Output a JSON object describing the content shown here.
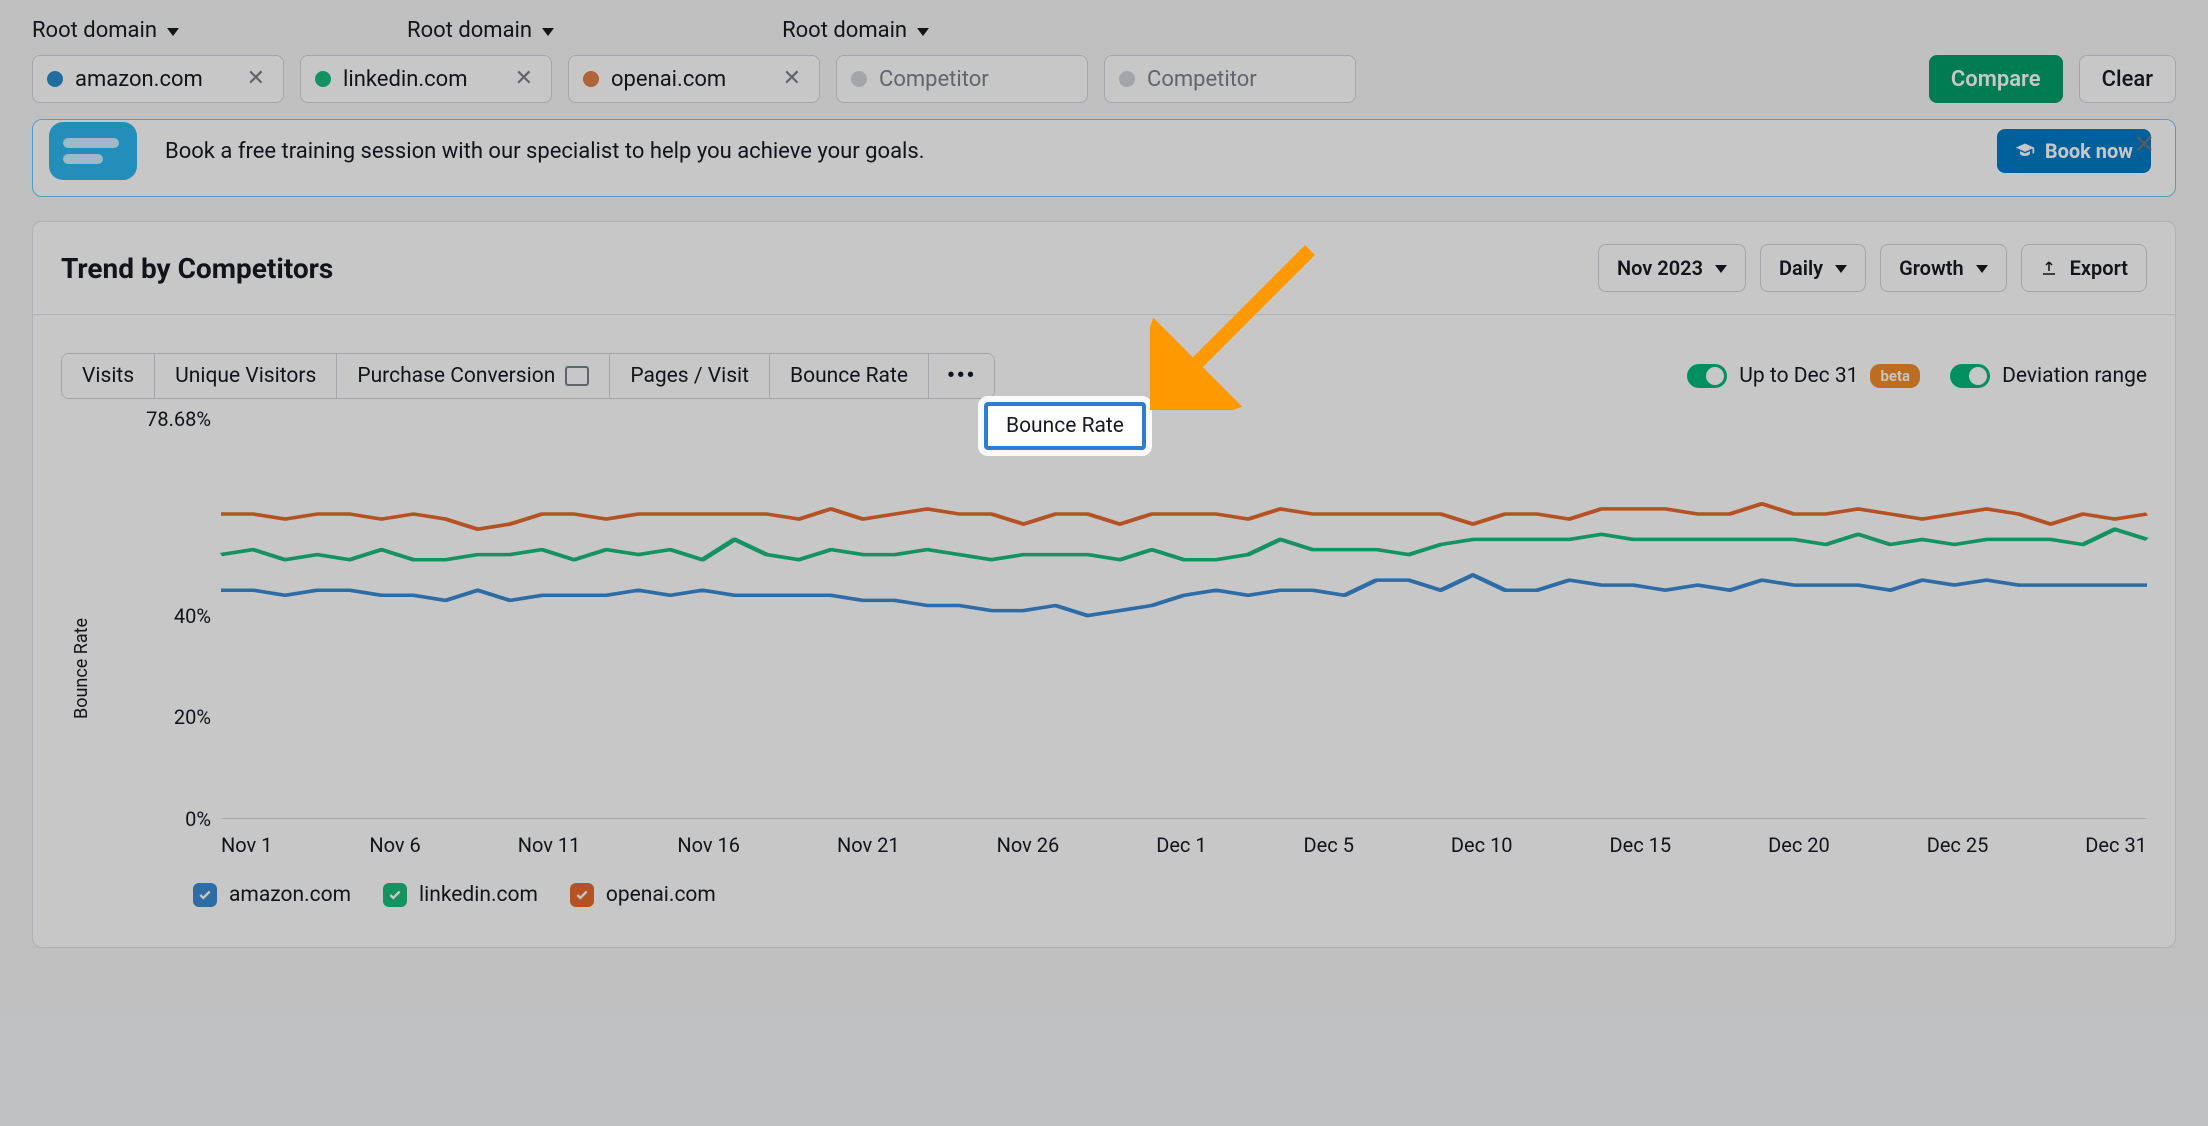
{
  "top": {
    "root_label": "Root domain",
    "competitors": [
      {
        "domain": "amazon.com",
        "color": "blue"
      },
      {
        "domain": "linkedin.com",
        "color": "green"
      },
      {
        "domain": "openai.com",
        "color": "orange"
      }
    ],
    "placeholder": "Competitor",
    "compare": "Compare",
    "clear": "Clear"
  },
  "banner": {
    "text": "Book a free training session with our specialist to help you achieve your goals.",
    "cta": "Book now"
  },
  "card": {
    "title": "Trend by Competitors",
    "period": "Nov 2023",
    "granularity": "Daily",
    "mode": "Growth",
    "export": "Export",
    "metrics": [
      "Visits",
      "Unique Visitors",
      "Purchase Conversion",
      "Pages / Visit",
      "Bounce Rate"
    ],
    "toggle_upto": {
      "label": "Up to Dec 31",
      "badge": "beta"
    },
    "toggle_dev": {
      "label": "Deviation range"
    },
    "ylabel": "Bounce Rate",
    "yticks": [
      "78.68%",
      "40%",
      "20%",
      "0%"
    ],
    "xticks": [
      "Nov 1",
      "Nov 6",
      "Nov 11",
      "Nov 16",
      "Nov 21",
      "Nov 26",
      "Dec 1",
      "Dec 5",
      "Dec 10",
      "Dec 15",
      "Dec 20",
      "Dec 25",
      "Dec 31"
    ],
    "legend": [
      "amazon.com",
      "linkedin.com",
      "openai.com"
    ]
  },
  "highlight": {
    "label": "Bounce Rate"
  },
  "chart_data": {
    "type": "line",
    "title": "Trend by Competitors — Bounce Rate",
    "xlabel": "",
    "ylabel": "Bounce Rate",
    "ylim": [
      0,
      78.68
    ],
    "categories": [
      "Nov 1",
      "Nov 2",
      "Nov 3",
      "Nov 4",
      "Nov 5",
      "Nov 6",
      "Nov 7",
      "Nov 8",
      "Nov 9",
      "Nov 10",
      "Nov 11",
      "Nov 12",
      "Nov 13",
      "Nov 14",
      "Nov 15",
      "Nov 16",
      "Nov 17",
      "Nov 18",
      "Nov 19",
      "Nov 20",
      "Nov 21",
      "Nov 22",
      "Nov 23",
      "Nov 24",
      "Nov 25",
      "Nov 26",
      "Nov 27",
      "Nov 28",
      "Nov 29",
      "Nov 30",
      "Dec 1",
      "Dec 2",
      "Dec 3",
      "Dec 4",
      "Dec 5",
      "Dec 6",
      "Dec 7",
      "Dec 8",
      "Dec 9",
      "Dec 10",
      "Dec 11",
      "Dec 12",
      "Dec 13",
      "Dec 14",
      "Dec 15",
      "Dec 16",
      "Dec 17",
      "Dec 18",
      "Dec 19",
      "Dec 20",
      "Dec 21",
      "Dec 22",
      "Dec 23",
      "Dec 24",
      "Dec 25",
      "Dec 26",
      "Dec 27",
      "Dec 28",
      "Dec 29",
      "Dec 30",
      "Dec 31"
    ],
    "series": [
      {
        "name": "amazon.com",
        "color": "#3b8bd4",
        "values": [
          45,
          45,
          44,
          45,
          45,
          44,
          44,
          43,
          45,
          43,
          44,
          44,
          44,
          45,
          44,
          45,
          44,
          44,
          44,
          44,
          43,
          43,
          42,
          42,
          41,
          41,
          42,
          40,
          41,
          42,
          44,
          45,
          44,
          45,
          45,
          44,
          47,
          47,
          45,
          48,
          45,
          45,
          47,
          46,
          46,
          45,
          46,
          45,
          47,
          46,
          46,
          46,
          45,
          47,
          46,
          47,
          46,
          46,
          46,
          46,
          46
        ]
      },
      {
        "name": "linkedin.com",
        "color": "#1abc7b",
        "values": [
          52,
          53,
          51,
          52,
          51,
          53,
          51,
          51,
          52,
          52,
          53,
          51,
          53,
          52,
          53,
          51,
          55,
          52,
          51,
          53,
          52,
          52,
          53,
          52,
          51,
          52,
          52,
          52,
          51,
          53,
          51,
          51,
          52,
          55,
          53,
          53,
          53,
          52,
          54,
          55,
          55,
          55,
          55,
          56,
          55,
          55,
          55,
          55,
          55,
          55,
          54,
          56,
          54,
          55,
          54,
          55,
          55,
          55,
          54,
          57,
          55
        ]
      },
      {
        "name": "openai.com",
        "color": "#e86a2e",
        "values": [
          60,
          60,
          59,
          60,
          60,
          59,
          60,
          59,
          57,
          58,
          60,
          60,
          59,
          60,
          60,
          60,
          60,
          60,
          59,
          61,
          59,
          60,
          61,
          60,
          60,
          58,
          60,
          60,
          58,
          60,
          60,
          60,
          59,
          61,
          60,
          60,
          60,
          60,
          60,
          58,
          60,
          60,
          59,
          61,
          61,
          61,
          60,
          60,
          62,
          60,
          60,
          61,
          60,
          59,
          60,
          61,
          60,
          58,
          60,
          59,
          60
        ]
      }
    ]
  }
}
